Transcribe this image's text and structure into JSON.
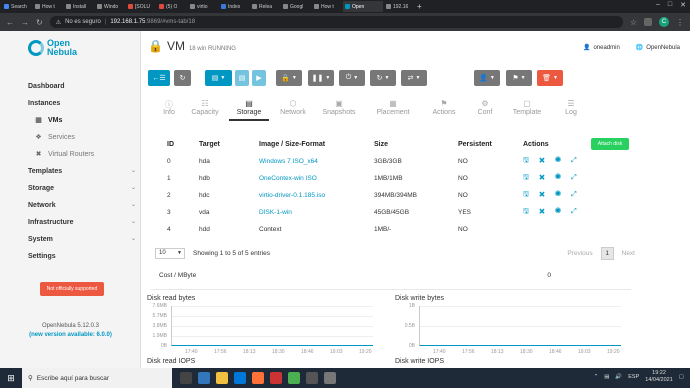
{
  "browser": {
    "tabs": [
      {
        "label": "Search",
        "color": "#4285f4",
        "active": false
      },
      {
        "label": "How t",
        "color": "#888888",
        "active": false
      },
      {
        "label": "Install",
        "color": "#888888",
        "active": false
      },
      {
        "label": "Windo",
        "color": "#888888",
        "active": false
      },
      {
        "label": "[SOLU",
        "color": "#e04a3a",
        "active": false
      },
      {
        "label": "(5) O",
        "color": "#e04a3a",
        "active": false
      },
      {
        "label": "virtio",
        "color": "#888888",
        "active": false
      },
      {
        "label": "Index",
        "color": "#3c78d8",
        "active": false
      },
      {
        "label": "Relea",
        "color": "#888888",
        "active": false
      },
      {
        "label": "Googl",
        "color": "#888888",
        "active": false
      },
      {
        "label": "How t",
        "color": "#888888",
        "active": false
      },
      {
        "label": "Open",
        "color": "#0098c3",
        "active": true
      },
      {
        "label": "192.16",
        "color": "#888888",
        "active": false
      }
    ],
    "security_warning": "No es seguro",
    "url_host": "192.168.1.75",
    "url_rest": ":9869/#vms-tab/18",
    "profile_initial": "C"
  },
  "sidebar": {
    "logo_line1": "Open",
    "logo_line2": "Nebula",
    "dashboard": "Dashboard",
    "instances": "Instances",
    "vms": "VMs",
    "services": "Services",
    "virtual_routers": "Virtual Routers",
    "templates": "Templates",
    "storage": "Storage",
    "network": "Network",
    "infrastructure": "Infrastructure",
    "system": "System",
    "settings": "Settings",
    "not_supported": "Not officially supported",
    "version": "OpenNebula 5.12.0.3",
    "new_version": "(new version available: 6.0.0)"
  },
  "header": {
    "vm_label": "VM",
    "vm_state": "18 win RUNNING",
    "user": "oneadmin",
    "zone": "OpenNebula"
  },
  "tabs": [
    {
      "icon": "ⓘ",
      "label": "Info"
    },
    {
      "icon": "☷",
      "label": "Capacity"
    },
    {
      "icon": "▤",
      "label": "Storage"
    },
    {
      "icon": "⬡",
      "label": "Network"
    },
    {
      "icon": "▣",
      "label": "Snapshots"
    },
    {
      "icon": "▦",
      "label": "Placement"
    },
    {
      "icon": "⚑",
      "label": "Actions"
    },
    {
      "icon": "⚙",
      "label": "Conf"
    },
    {
      "icon": "▢",
      "label": "Template"
    },
    {
      "icon": "☰",
      "label": "Log"
    }
  ],
  "disks": {
    "columns": [
      "ID",
      "Target",
      "Image / Size-Format",
      "Size",
      "Persistent",
      "Actions"
    ],
    "attach_label": "Attach disk",
    "rows": [
      {
        "id": "0",
        "target": "hda",
        "image": "Windows 7 ISO_x64",
        "size": "3GB/3GB",
        "persistent": "NO",
        "link": true
      },
      {
        "id": "1",
        "target": "hdb",
        "image": "OneContex-win ISO",
        "size": "1MB/1MB",
        "persistent": "NO",
        "link": true
      },
      {
        "id": "2",
        "target": "hdc",
        "image": "virtio-driver-0.1.185.iso",
        "size": "394MB/394MB",
        "persistent": "NO",
        "link": true
      },
      {
        "id": "3",
        "target": "vda",
        "image": "DISK-1-win",
        "size": "45GB/45GB",
        "persistent": "YES",
        "link": true
      },
      {
        "id": "4",
        "target": "hdd",
        "image": "Context",
        "size": "1MB/-",
        "persistent": "NO",
        "link": false
      }
    ]
  },
  "pager": {
    "page_size": "10",
    "info": "Showing 1 to 5 of 5 entries",
    "previous": "Previous",
    "current": "1",
    "next": "Next"
  },
  "cost": {
    "label": "Cost / MByte",
    "value": "0"
  },
  "graphs": {
    "read_title": "Disk read bytes",
    "read_y": [
      "7.6MB",
      "5.7MB",
      "3.8MB",
      "1.9MB",
      "0B"
    ],
    "write_title": "Disk write bytes",
    "write_y": [
      "1B",
      "0.5B",
      "0B"
    ],
    "x_ticks": [
      "17:40",
      "17:56",
      "18:13",
      "18:30",
      "18:46",
      "19:03",
      "19:20"
    ],
    "read_iops": "Disk read IOPS",
    "write_iops": "Disk write IOPS"
  },
  "taskbar": {
    "search_placeholder": "Escribe aquí para buscar",
    "lang": "ESP",
    "time": "19:22",
    "date": "14/04/2021"
  }
}
